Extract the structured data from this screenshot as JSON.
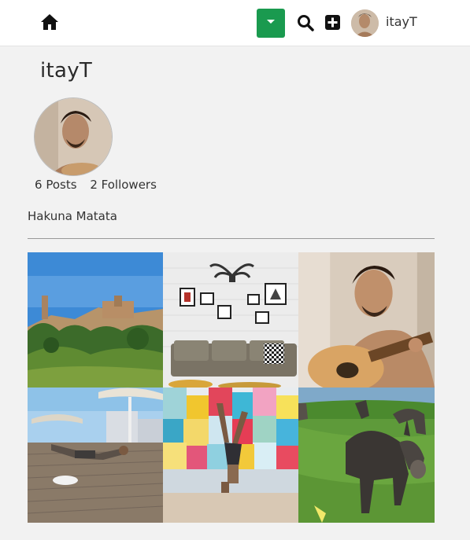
{
  "navbar": {
    "username": "itayT",
    "icons": [
      "home-icon",
      "caret-down-icon",
      "search-icon",
      "plus-square-icon"
    ],
    "dropdown_color": "#1a9a4f"
  },
  "profile": {
    "name": "itayT",
    "posts_count": "6",
    "posts_label": "Posts",
    "followers_count": "2",
    "followers_label": "Followers",
    "bio": "Hakuna Matata"
  },
  "gallery": {
    "posts": [
      {
        "id": 1,
        "subject": "hilltop castle with green trees"
      },
      {
        "id": 2,
        "subject": "living room with antler mount and picture frames"
      },
      {
        "id": 3,
        "subject": "man playing acoustic guitar"
      },
      {
        "id": 4,
        "subject": "person doing handstand on boardwalk under umbrella"
      },
      {
        "id": 5,
        "subject": "handstand in front of colorful glass wall"
      },
      {
        "id": 6,
        "subject": "donkeys on green grass"
      }
    ]
  }
}
